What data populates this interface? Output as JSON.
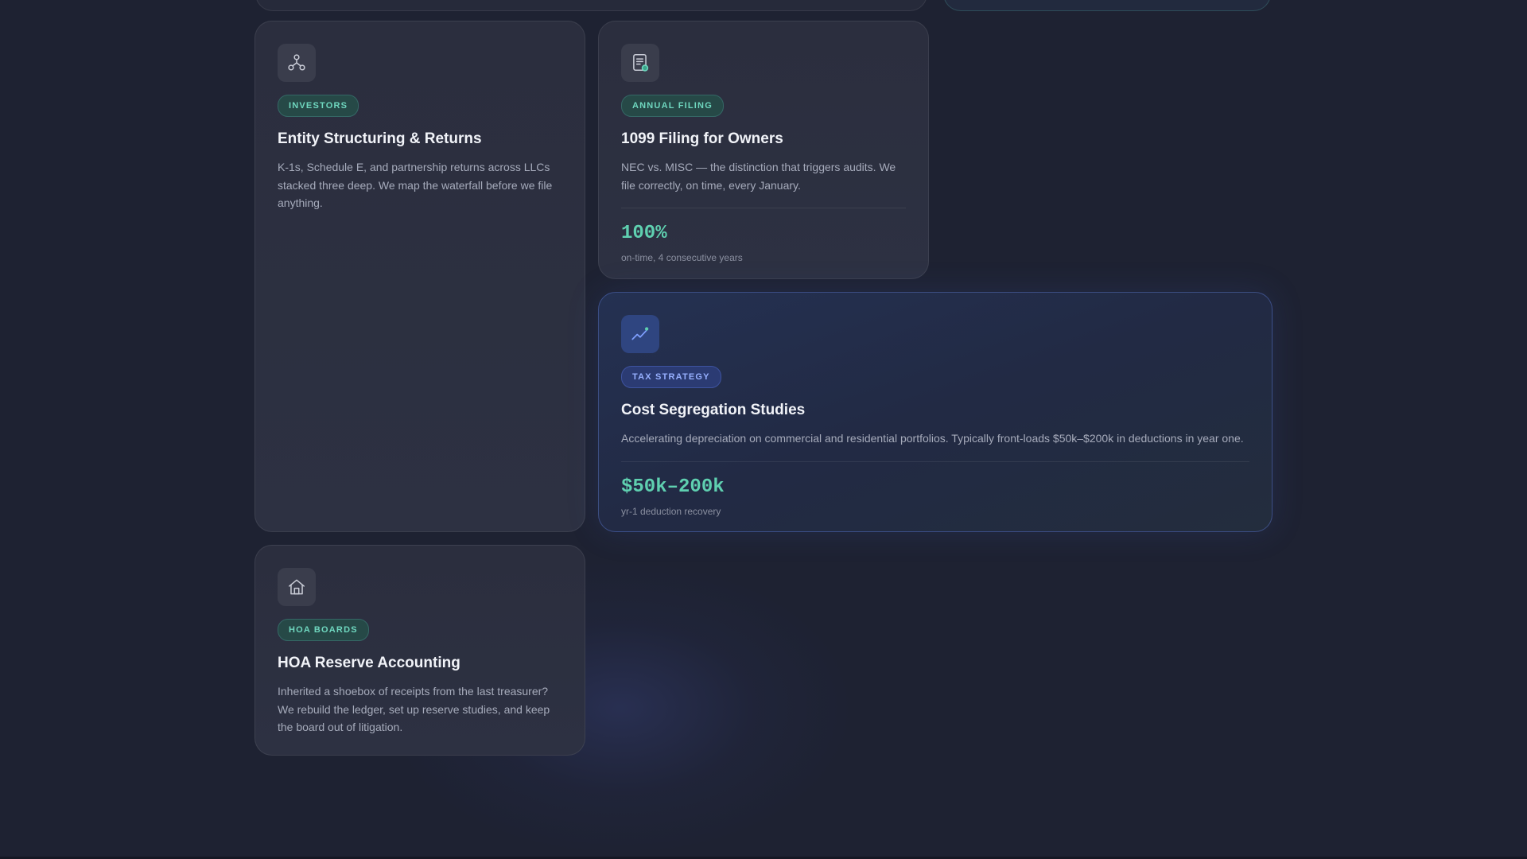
{
  "colors": {
    "background": "#1e2232",
    "card": "#2c2f40",
    "accent_teal": "#6fd7bf",
    "accent_blue": "#97b0ff",
    "stat": "#5fd0b0"
  },
  "cards": [
    {
      "icon": "network-nodes-icon",
      "badge": "INVESTORS",
      "title": "Entity Structuring & Returns",
      "description": "K-1s, Schedule E, and partnership returns across LLCs stacked three deep. We map the waterfall before we file anything."
    },
    {
      "icon": "document-check-icon",
      "badge": "ANNUAL FILING",
      "title": "1099 Filing for Owners",
      "description": "NEC vs. MISC — the distinction that triggers audits. We file correctly, on time, every January.",
      "stat": "100%",
      "stat_label": "on-time, 4 consecutive years"
    },
    {
      "icon": "trend-chart-icon",
      "badge": "TAX STRATEGY",
      "title": "Cost Segregation Studies",
      "description": "Accelerating depreciation on commercial and residential portfolios. Typically front-loads $50k–$200k in deductions in year one.",
      "stat": "$50k–200k",
      "stat_label": "yr-1 deduction recovery"
    },
    {
      "icon": "house-icon",
      "badge": "HOA BOARDS",
      "title": "HOA Reserve Accounting",
      "description": "Inherited a shoebox of receipts from the last treasurer? We rebuild the ledger, set up reserve studies, and keep the board out of litigation."
    }
  ]
}
